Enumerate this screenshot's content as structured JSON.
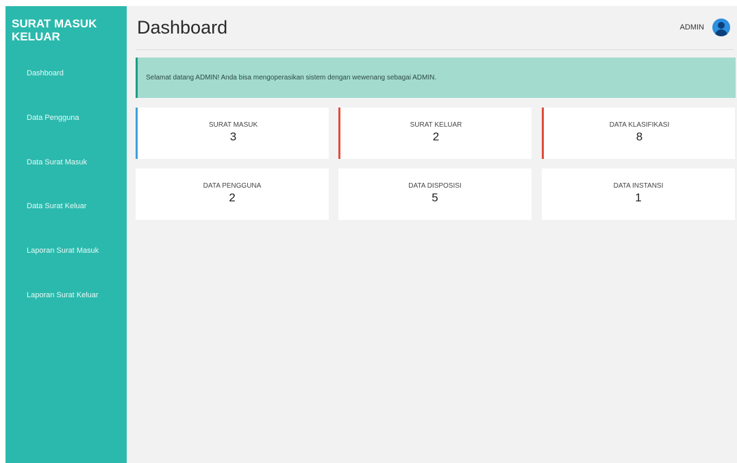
{
  "sidebar": {
    "brand": "SURAT MASUK KELUAR",
    "items": [
      {
        "label": "Dashboard"
      },
      {
        "label": "Data Pengguna"
      },
      {
        "label": "Data Surat Masuk"
      },
      {
        "label": "Data Surat Keluar"
      },
      {
        "label": "Laporan Surat Masuk"
      },
      {
        "label": "Laporan Surat Keluar"
      }
    ]
  },
  "header": {
    "title": "Dashboard",
    "user_name": "ADMIN",
    "avatar_icon": "user-circle-icon"
  },
  "alert": {
    "message": "Selamat datang ADMIN! Anda bisa mengoperasikan sistem dengan wewenang sebagai ADMIN."
  },
  "cards": [
    {
      "label": "SURAT MASUK",
      "value": "3",
      "accent": "#3da0d8"
    },
    {
      "label": "SURAT KELUAR",
      "value": "2",
      "accent": "#e34b3b"
    },
    {
      "label": "DATA KLASIFIKASI",
      "value": "8",
      "accent": "#e34b3b"
    },
    {
      "label": "DATA PENGGUNA",
      "value": "2",
      "accent": ""
    },
    {
      "label": "DATA DISPOSISI",
      "value": "5",
      "accent": ""
    },
    {
      "label": "DATA INSTANSI",
      "value": "1",
      "accent": ""
    }
  ],
  "colors": {
    "sidebar": "#2bb9ad",
    "alert_bg": "#a3dbcf",
    "content_bg": "#f2f2f2"
  }
}
